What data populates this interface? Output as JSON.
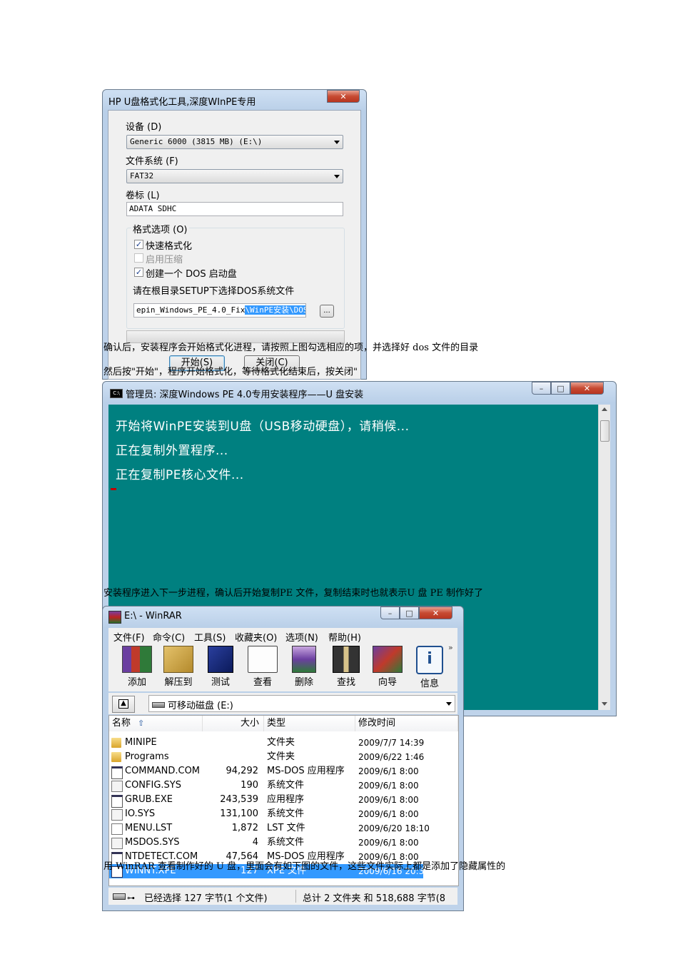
{
  "dialog1": {
    "title": "HP U盘格式化工具,深度WInPE专用",
    "device_label": "设备 (D)",
    "device_value": "Generic  6000 (3815 MB) (E:\\)",
    "fs_label": "文件系统 (F)",
    "fs_value": "FAT32",
    "volume_label": "卷标 (L)",
    "volume_value": "ADATA SDHC",
    "options_label": "格式选项 (O)",
    "quick_format": "快速格式化",
    "enable_compression": "启用压缩",
    "create_dos": "创建一个 DOS 启动盘",
    "dos_hint": "请在根目录SETUP下选择DOS系统文件",
    "path_value": "epin_Windows_PE_4.0_Fix",
    "path_selected": "\\WinPE安装\\DOS",
    "browse_label": "...",
    "start_label": "开始(S)",
    "close_label": "关闭(C)"
  },
  "captions": {
    "c1": "确认后，安装程序会开始格式化进程，请按照上图勾选相应的项，并选择好 dos 文件的目录",
    "c2": "然后按\"开始\"，程序开始格式化，等待格式化结束后，按关闭\"",
    "c3a": "安装程序进入下一步进程，确认后开始复制",
    "c3b": "PE 文件，复制结束时也就表示",
    "c3c": "U 盘 PE 制作好了",
    "c4": "用 WinRAR 查看制作好的 U 盘，里面会有如下图的文件，这些文件实际上都是添加了隐藏属性的"
  },
  "console": {
    "title": "管理员: 深度Windows PE 4.0专用安装程序——U 盘安装",
    "lines": [
      "开始将WinPE安装到U盘（USB移动硬盘），请稍候...",
      "正在复制外置程序...",
      "正在复制PE核心文件..."
    ]
  },
  "winrar": {
    "title": "E:\\ - WinRAR",
    "menu": [
      "文件(F)",
      "命令(C)",
      "工具(S)",
      "收藏夹(O)",
      "选项(N)",
      "帮助(H)"
    ],
    "tools": [
      "添加",
      "解压到",
      "测试",
      "查看",
      "删除",
      "查找",
      "向导",
      "信息"
    ],
    "more": "»",
    "address": "可移动磁盘 (E:)",
    "columns": [
      "名称",
      "大小",
      "类型",
      "修改时间"
    ],
    "files": [
      {
        "name": "MINIPE",
        "size": "",
        "type": "文件夹",
        "modified": "2009/7/7 14:39"
      },
      {
        "name": "Programs",
        "size": "",
        "type": "文件夹",
        "modified": "2009/6/22 1:46"
      },
      {
        "name": "COMMAND.COM",
        "size": "94,292",
        "type": "MS-DOS 应用程序",
        "modified": "2009/6/1 8:00"
      },
      {
        "name": "CONFIG.SYS",
        "size": "190",
        "type": "系统文件",
        "modified": "2009/6/1 8:00"
      },
      {
        "name": "GRUB.EXE",
        "size": "243,539",
        "type": "应用程序",
        "modified": "2009/6/1 8:00"
      },
      {
        "name": "IO.SYS",
        "size": "131,100",
        "type": "系统文件",
        "modified": "2009/6/1 8:00"
      },
      {
        "name": "MENU.LST",
        "size": "1,872",
        "type": "LST 文件",
        "modified": "2009/6/20 18:10"
      },
      {
        "name": "MSDOS.SYS",
        "size": "4",
        "type": "系统文件",
        "modified": "2009/6/1 8:00"
      },
      {
        "name": "NTDETECT.COM",
        "size": "47,564",
        "type": "MS-DOS 应用程序",
        "modified": "2009/6/1 8:00"
      },
      {
        "name": "WINNT.XPE",
        "size": "127",
        "type": "XPE 文件",
        "modified": "2009/6/16 20:38"
      }
    ],
    "status_left": "已经选择 127 字节(1 个文件)",
    "status_right": "总计 2 文件夹 和 518,688 字节(8"
  },
  "colors": {
    "console_bg": "#008080",
    "selection": "#3399ff",
    "close_red": "#c74a32"
  }
}
